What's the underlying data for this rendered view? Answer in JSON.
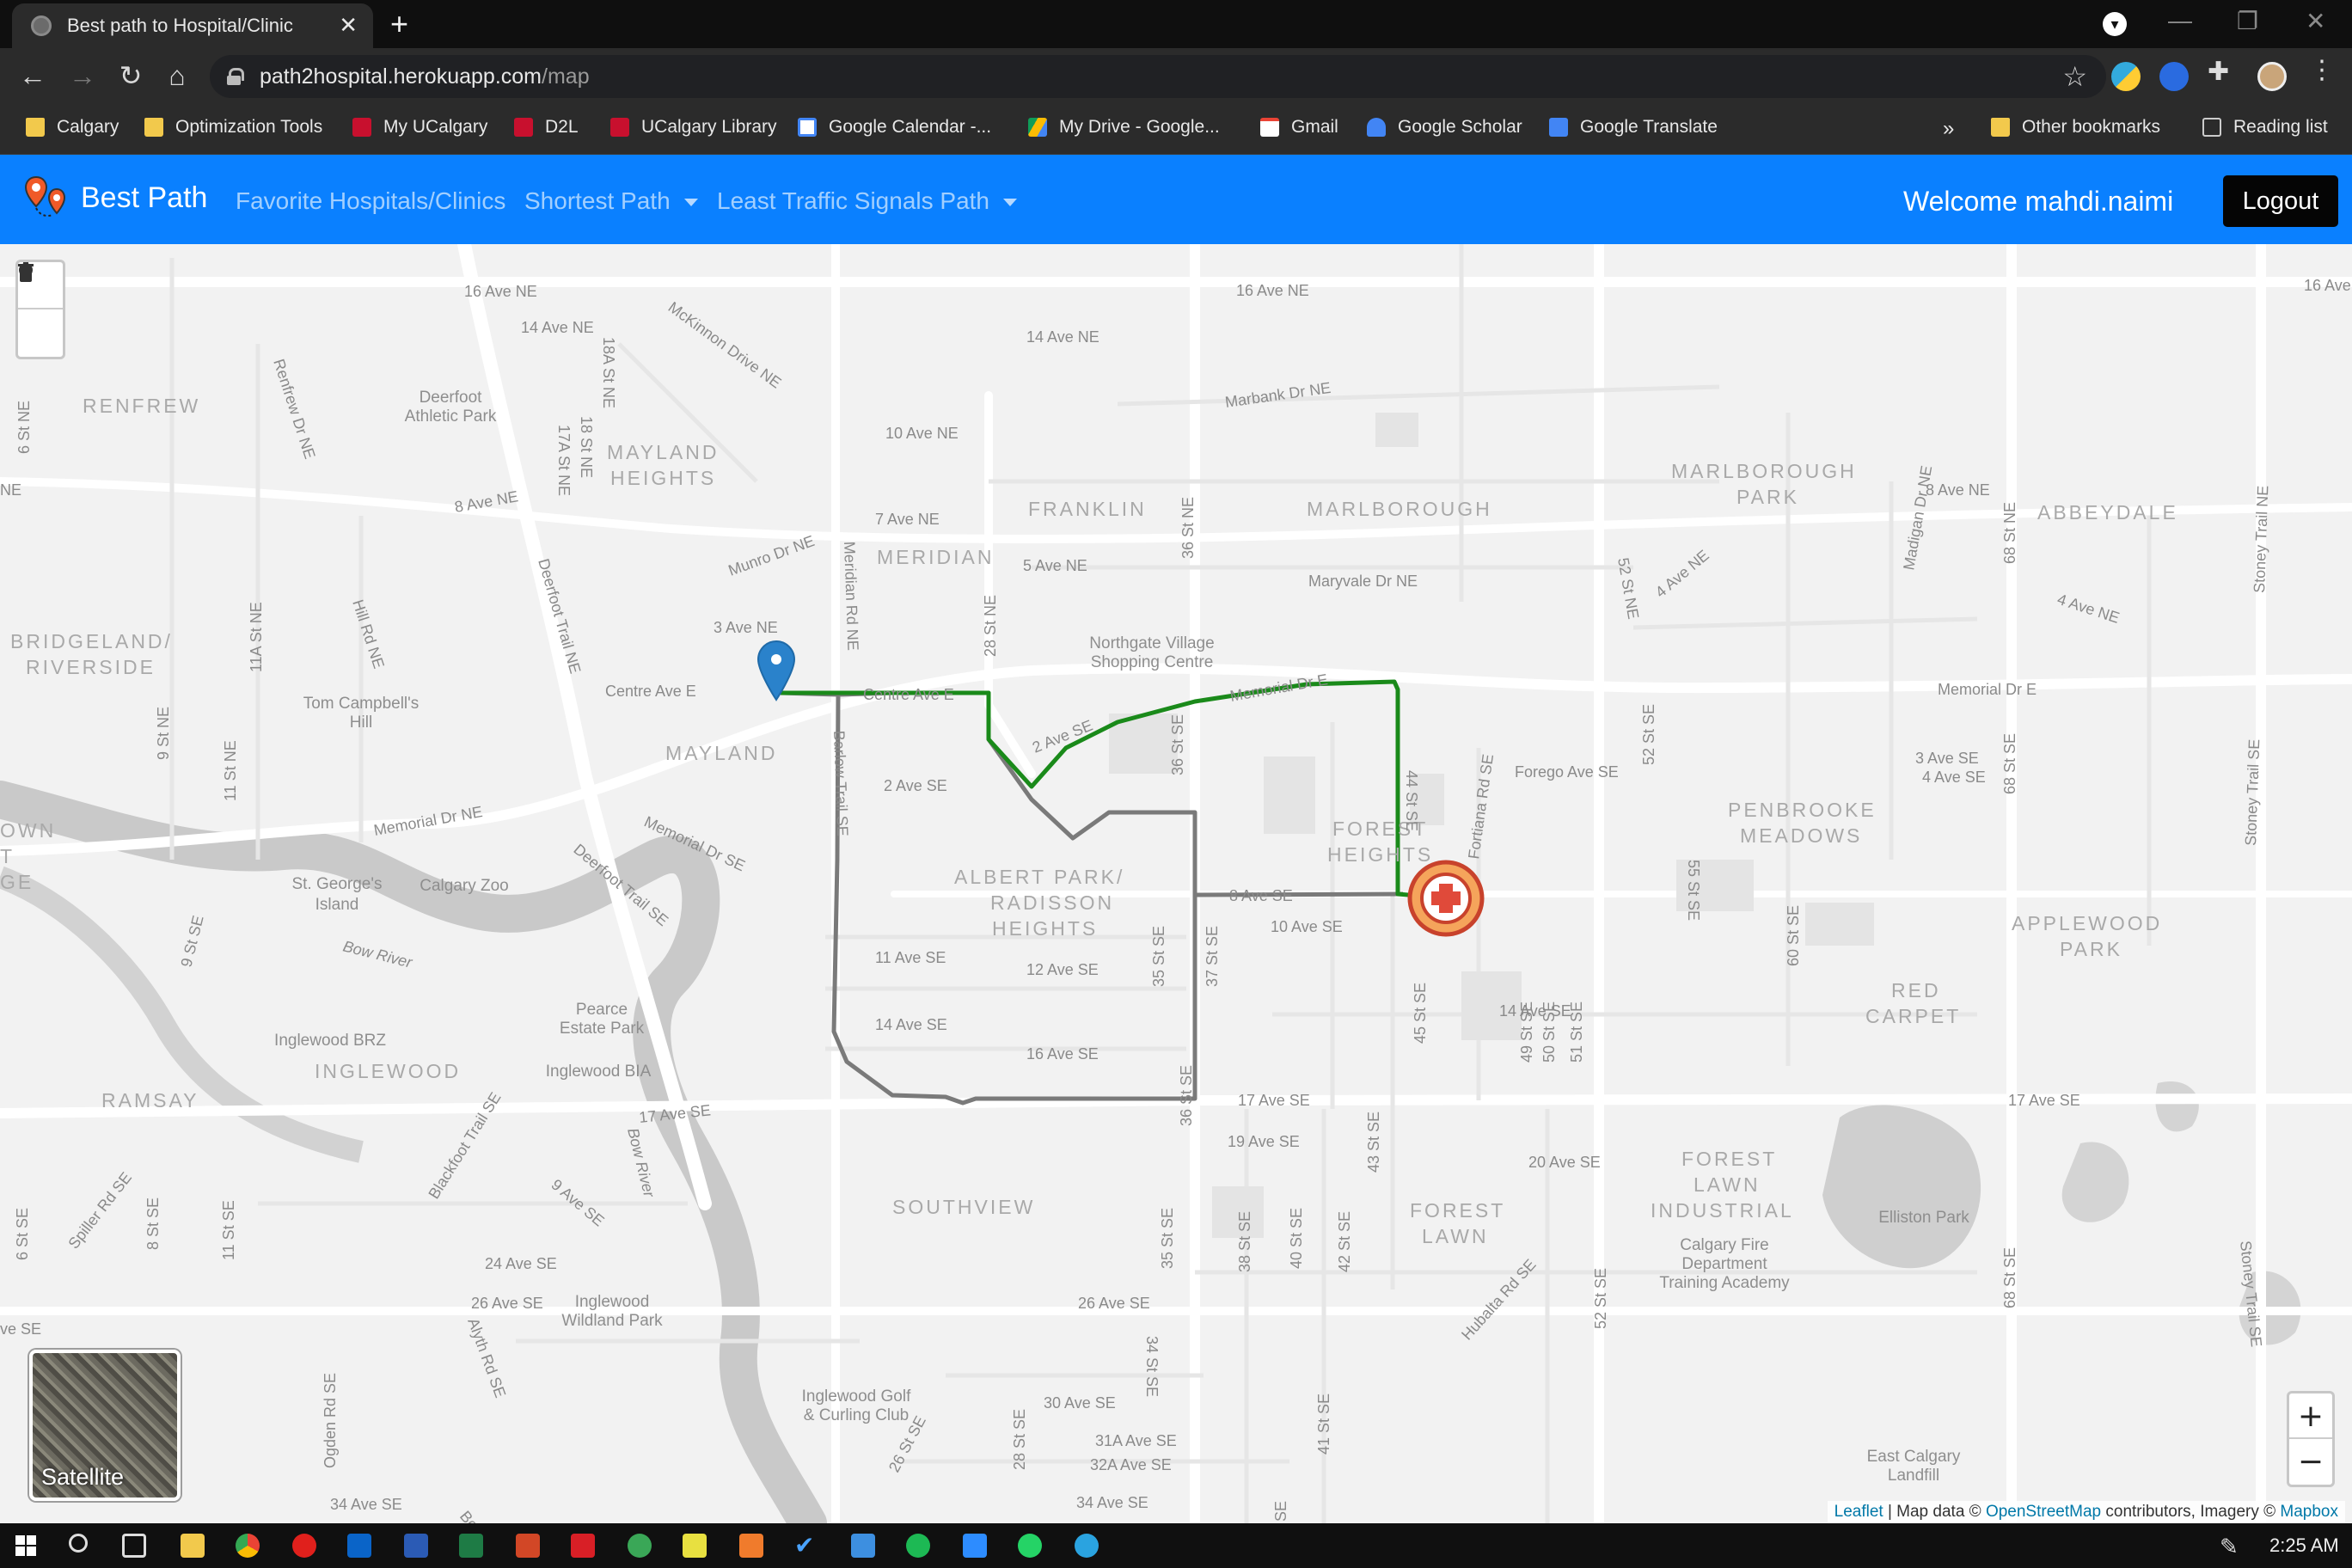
{
  "browser": {
    "tab_title": "Best path to Hospital/Clinic",
    "tab_close": "✕",
    "new_tab": "+",
    "url_host": "path2hospital.herokuapp.com",
    "url_path": "/map"
  },
  "bookmarks": [
    {
      "label": "Calgary",
      "icon": "folder"
    },
    {
      "label": "Optimization Tools",
      "icon": "folder"
    },
    {
      "label": "My UCalgary",
      "icon": "ucalgary-crest"
    },
    {
      "label": "D2L",
      "icon": "ucalgary-crest"
    },
    {
      "label": "UCalgary Library",
      "icon": "ucalgary-crest"
    },
    {
      "label": "Google Calendar -...",
      "icon": "calendar"
    },
    {
      "label": "My Drive - Google...",
      "icon": "drive"
    },
    {
      "label": "Gmail",
      "icon": "gmail"
    },
    {
      "label": "Google Scholar",
      "icon": "scholar"
    },
    {
      "label": "Google Translate",
      "icon": "translate"
    }
  ],
  "bookmarks_more": "»",
  "bookmarks_other": "Other bookmarks",
  "bookmarks_reading": "Reading list",
  "app": {
    "brand": "Best Path",
    "nav": {
      "favorites": "Favorite Hospitals/Clinics",
      "shortest": "Shortest Path",
      "least_signals": "Least Traffic Signals Path"
    },
    "welcome": "Welcome mahdi.naimi",
    "logout": "Logout"
  },
  "map": {
    "base_layer_toggle": "Satellite",
    "zoom_in": "+",
    "zoom_out": "−",
    "attribution": {
      "leaflet": "Leaflet",
      "sep": " | Map data © ",
      "osm": "OpenStreetMap",
      "mid": " contributors, Imagery © ",
      "mapbox": "Mapbox"
    },
    "route_colors": {
      "least_signals": "#1a8a1a",
      "shortest": "#7a7a7a"
    },
    "labels": {
      "neighbourhoods": [
        "RENFREW",
        "MAYLAND",
        "HEIGHTS",
        "FRANKLIN",
        "MARLBOROUGH",
        "MARLBOROUGH",
        "PARK",
        "ABBEYDALE",
        "MERIDIAN",
        "BRIDGELAND/",
        "RIVERSIDE",
        "MAYLAND",
        "FOREST",
        "HEIGHTS",
        "PENBROOKE",
        "MEADOWS",
        "ALBERT PARK/",
        "RADISSON",
        "HEIGHTS",
        "APPLEWOOD",
        "PARK",
        "RED",
        "CARPET",
        "INGLEWOOD",
        "RAMSAY",
        "SOUTHVIEW",
        "FOREST",
        "LAWN",
        "FOREST",
        "LAWN",
        "INDUSTRIAL",
        "OWN",
        "T",
        "GE"
      ],
      "streets": [
        "16 Ave NE",
        "16 Ave NE",
        "16 Ave",
        "14 Ave NE",
        "14 Ave NE",
        "McKinnon Drive NE",
        "10 Ave NE",
        "8 Ave NE",
        "8 Ave NE",
        "7 Ave NE",
        "5 Ave NE",
        "3 Ave NE",
        "Centre Ave E",
        "Centre Ave E",
        "Memorial Dr E",
        "Memorial Dr E",
        "Memorial Dr NE",
        "Memorial Dr SE",
        "Deerfoot Trail NE",
        "Deerfoot Trail SE",
        "2 Ave SE",
        "2 Ave SE",
        "8 Ave SE",
        "10 Ave SE",
        "11 Ave SE",
        "12 Ave SE",
        "14 Ave SE",
        "14 Ave SE",
        "16 Ave SE",
        "17 Ave SE",
        "17 Ave SE",
        "17 Ave SE",
        "19 Ave SE",
        "20 Ave SE",
        "24 Ave SE",
        "26 Ave SE",
        "26 Ave SE",
        "30 Ave SE",
        "31A Ave SE",
        "32A Ave SE",
        "34 Ave SE",
        "34 Ave SE",
        "Marbank Dr NE",
        "Maryvale Dr NE",
        "Munro Dr NE",
        "Forego Ave SE",
        "3 Ave SE",
        "4 Ave SE",
        "4 Ave NE",
        "4 Ave NE",
        "Barlow Trail SE",
        "Meridian Rd NE",
        "36 St NE",
        "28 St NE",
        "52 St NE",
        "52 St SE",
        "52 St SE",
        "68 St NE",
        "68 St SE",
        "68 St SE",
        "Stoney Trail NE",
        "Stoney Trail SE",
        "Stoney Trail SE",
        "Fortiana Rd SE",
        "44 St SE",
        "45 St SE",
        "49 St SE",
        "50 St SE",
        "51 St SE",
        "55 St SE",
        "60 St SE",
        "36 St SE",
        "36 St SE",
        "35 St SE",
        "37 St SE",
        "38 St SE",
        "40 St SE",
        "42 St SE",
        "43 St SE",
        "34 St SE",
        "35 St SE",
        "41 St SE",
        "28 St SE",
        "26 St SE",
        "Madigan Dr NE",
        "Renfrew Dr NE",
        "Hill Rd NE",
        "17A St NE",
        "18 St NE",
        "18A St NE",
        "11A St NE",
        "9 St NE",
        "11 St NE",
        "6 St NE",
        "NE",
        "9 St SE",
        "8 St SE",
        "11 St SE",
        "6 St SE",
        "Spiller Rd SE",
        "Blackfoot Trail SE",
        "9 Ave SE",
        "Alyth Rd SE",
        "Ogden Rd SE",
        "Bow River",
        "Bow River",
        "Hubalta Rd SE",
        "ve SE",
        "SE",
        "Bon"
      ],
      "places": [
        "Deerfoot",
        "Athletic Park",
        "Tom Campbell's",
        "Hill",
        "St. George's",
        "Island",
        "Calgary Zoo",
        "Pearce",
        "Estate Park",
        "Inglewood BRZ",
        "Inglewood BIA",
        "Inglewood",
        "Wildland Park",
        "Inglewood Golf",
        "& Curling Club",
        "Northgate Village",
        "Shopping Centre",
        "Elliston Park",
        "Calgary Fire",
        "Department",
        "Training Academy",
        "East Calgary",
        "Landfill"
      ]
    }
  },
  "taskbar": {
    "clock": "2:25 AM"
  }
}
